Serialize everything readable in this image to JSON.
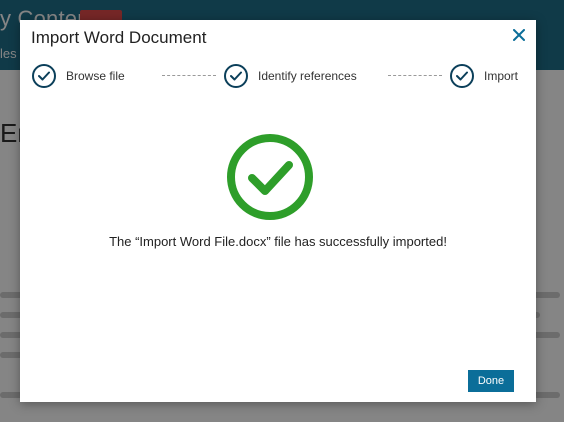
{
  "background": {
    "app_title": "y Content",
    "subnav": "les",
    "heading_fragment": "En"
  },
  "modal": {
    "title": "Import Word Document",
    "close_icon": "close-icon",
    "steps": [
      {
        "label": "Browse file",
        "icon": "check-circle-icon",
        "completed": true
      },
      {
        "label": "Identify references",
        "icon": "check-circle-icon",
        "completed": true
      },
      {
        "label": "Import",
        "icon": "check-circle-icon",
        "completed": true
      }
    ],
    "success_icon": "success-check-icon",
    "message": "The “Import Word File.docx” file has successfully imported!",
    "done_label": "Done"
  },
  "colors": {
    "accent": "#0b6e99",
    "step_icon": "#0b3f5a",
    "success": "#2e9e2a",
    "header": "#1f6f8b"
  }
}
